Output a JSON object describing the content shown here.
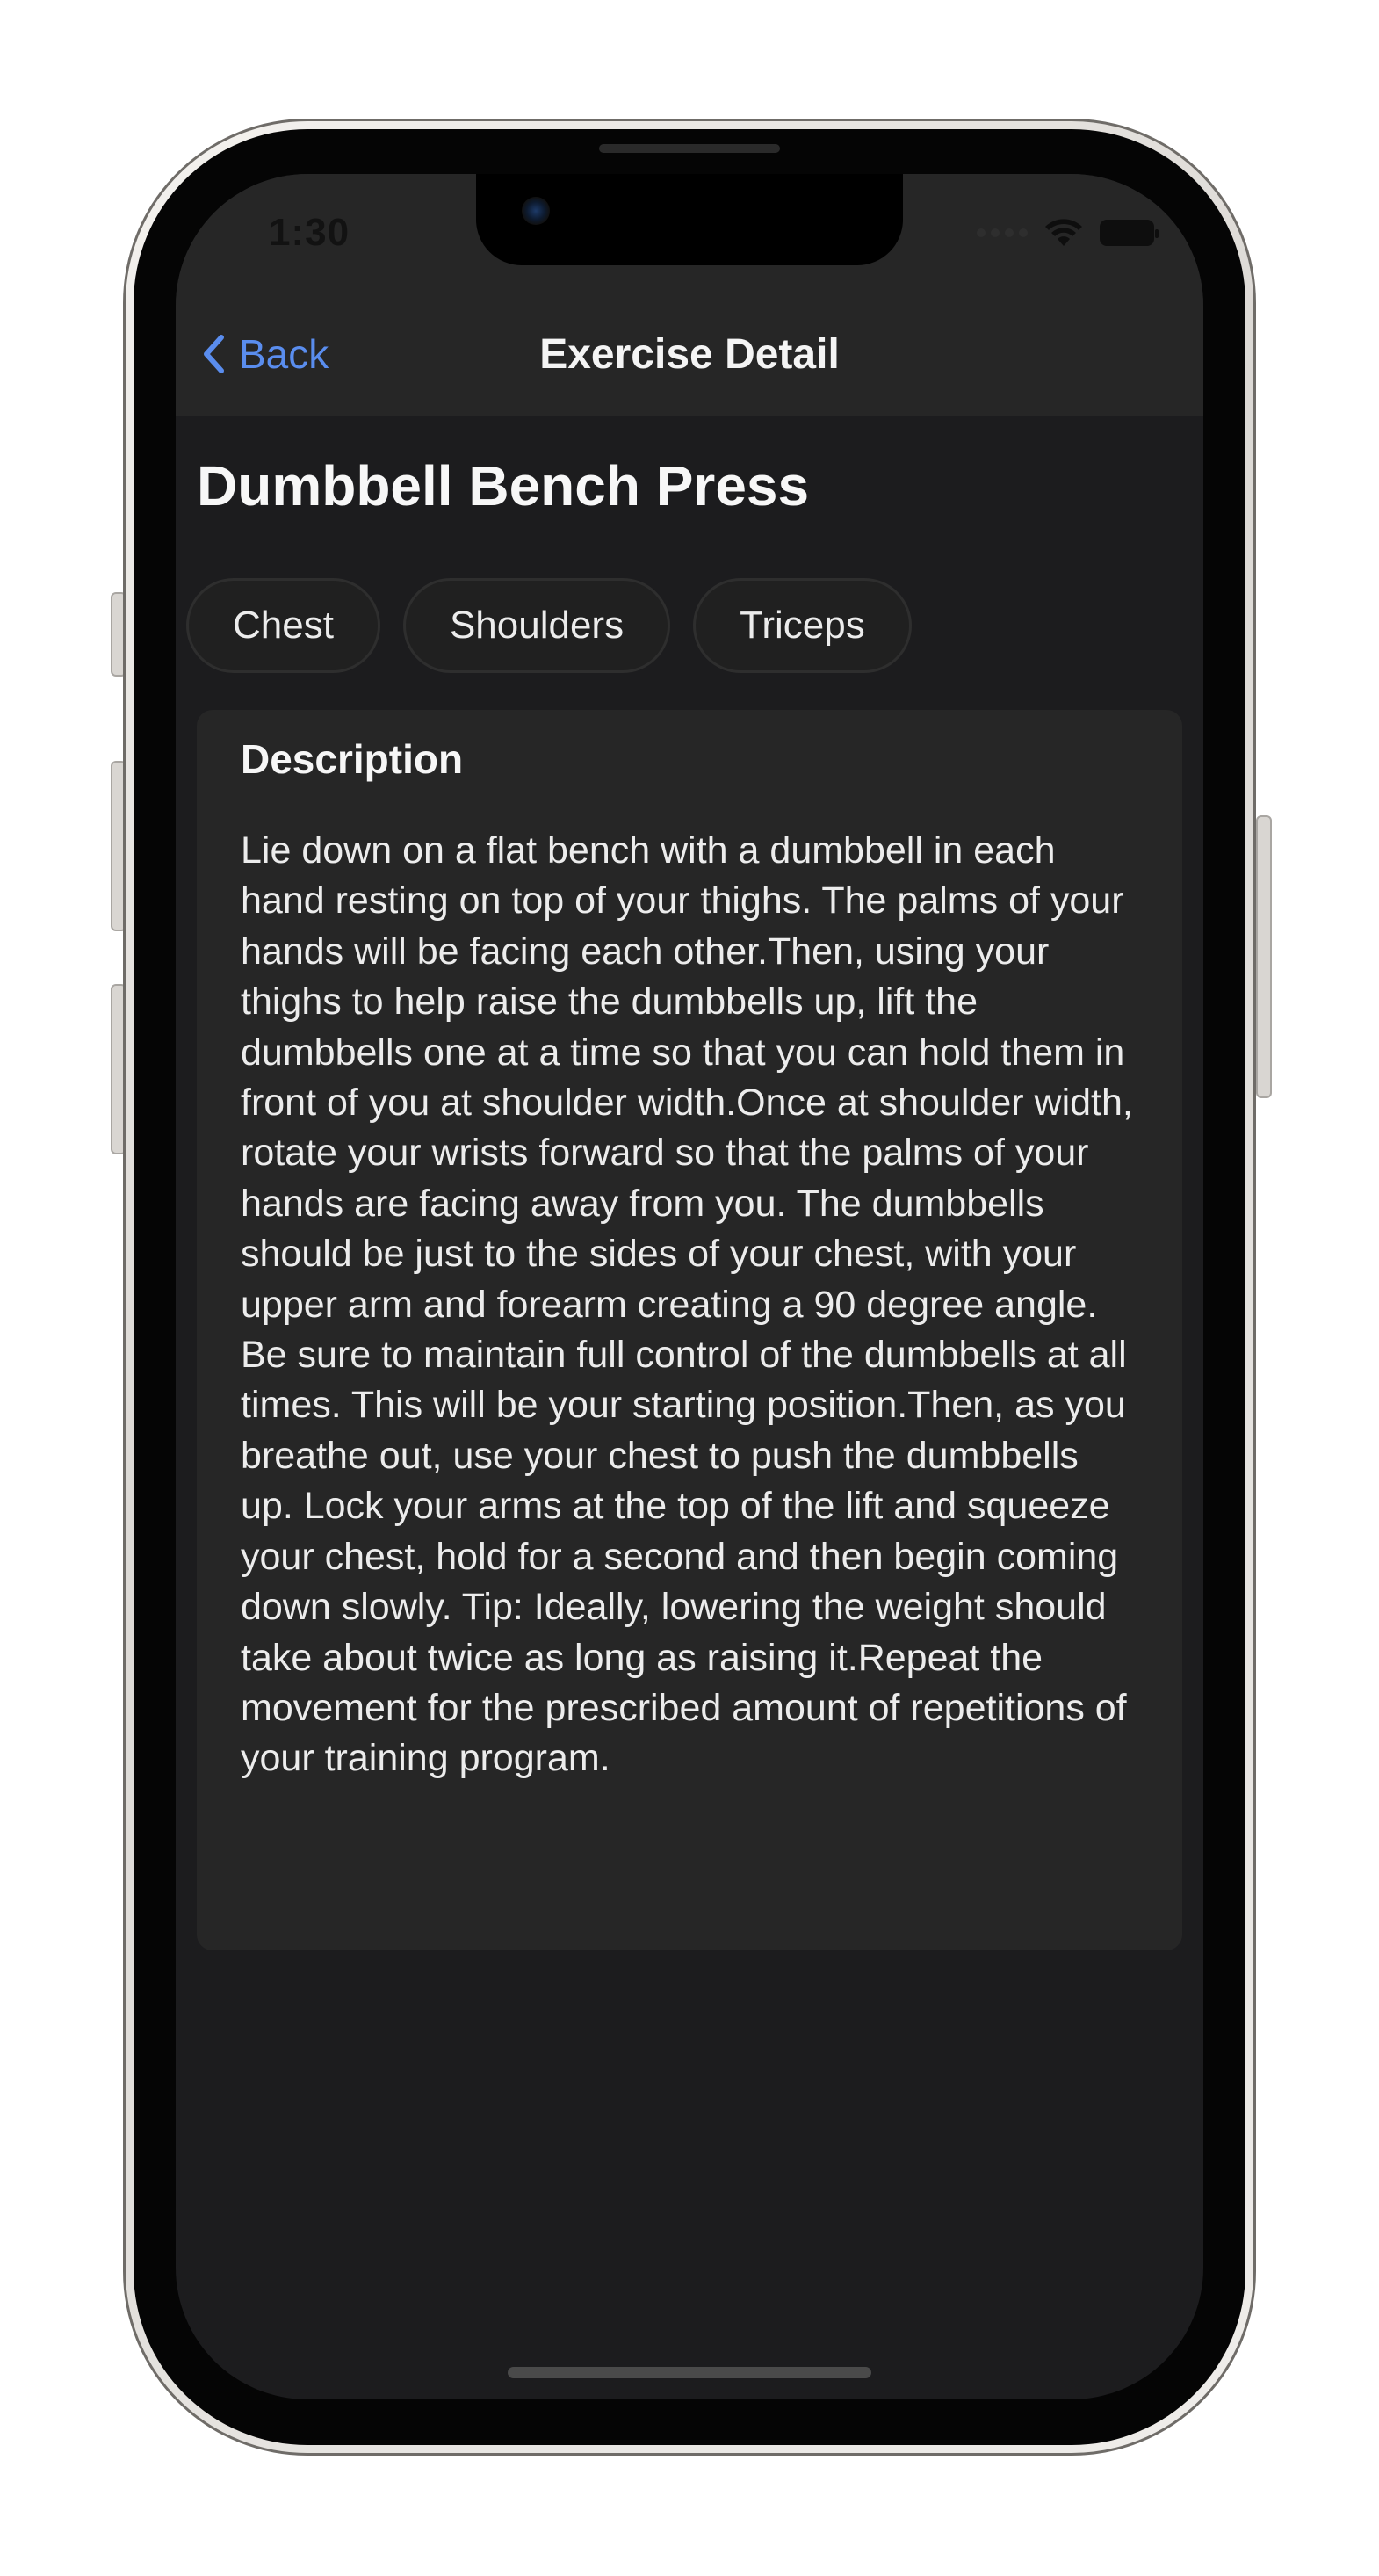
{
  "status_bar": {
    "time": "1:30"
  },
  "nav": {
    "back_label": "Back",
    "title": "Exercise Detail"
  },
  "exercise": {
    "name": "Dumbbell Bench Press",
    "muscles": [
      "Chest",
      "Shoulders",
      "Triceps"
    ],
    "description_heading": "Description",
    "description": "Lie down on a flat bench with a dumbbell in each hand resting on top of your thighs. The palms of your hands will be facing each other.Then, using your thighs to help raise the dumbbells up, lift the dumbbells one at a time so that you can hold them in front of you at shoulder width.Once at shoulder width, rotate your wrists forward so that the palms of your hands are facing away from you. The dumbbells should be just to the sides of your chest, with your upper arm and forearm creating a 90 degree angle. Be sure to maintain full control of the dumbbells at all times. This will be your starting position.Then, as you breathe out, use your chest to push the dumbbells up. Lock your arms at the top of the lift and squeeze your chest, hold for a second and then begin coming down slowly. Tip: Ideally, lowering the weight should take about twice as long as raising it.Repeat the movement for the prescribed amount of repetitions of your training program."
  },
  "colors": {
    "accent": "#5a8dee",
    "background": "#1c1c1e",
    "navbar": "#262626",
    "card": "#262626"
  },
  "icons": {
    "back": "chevron-left-icon",
    "wifi": "wifi-icon",
    "battery": "battery-icon",
    "signal": "cellular-signal-icon"
  }
}
